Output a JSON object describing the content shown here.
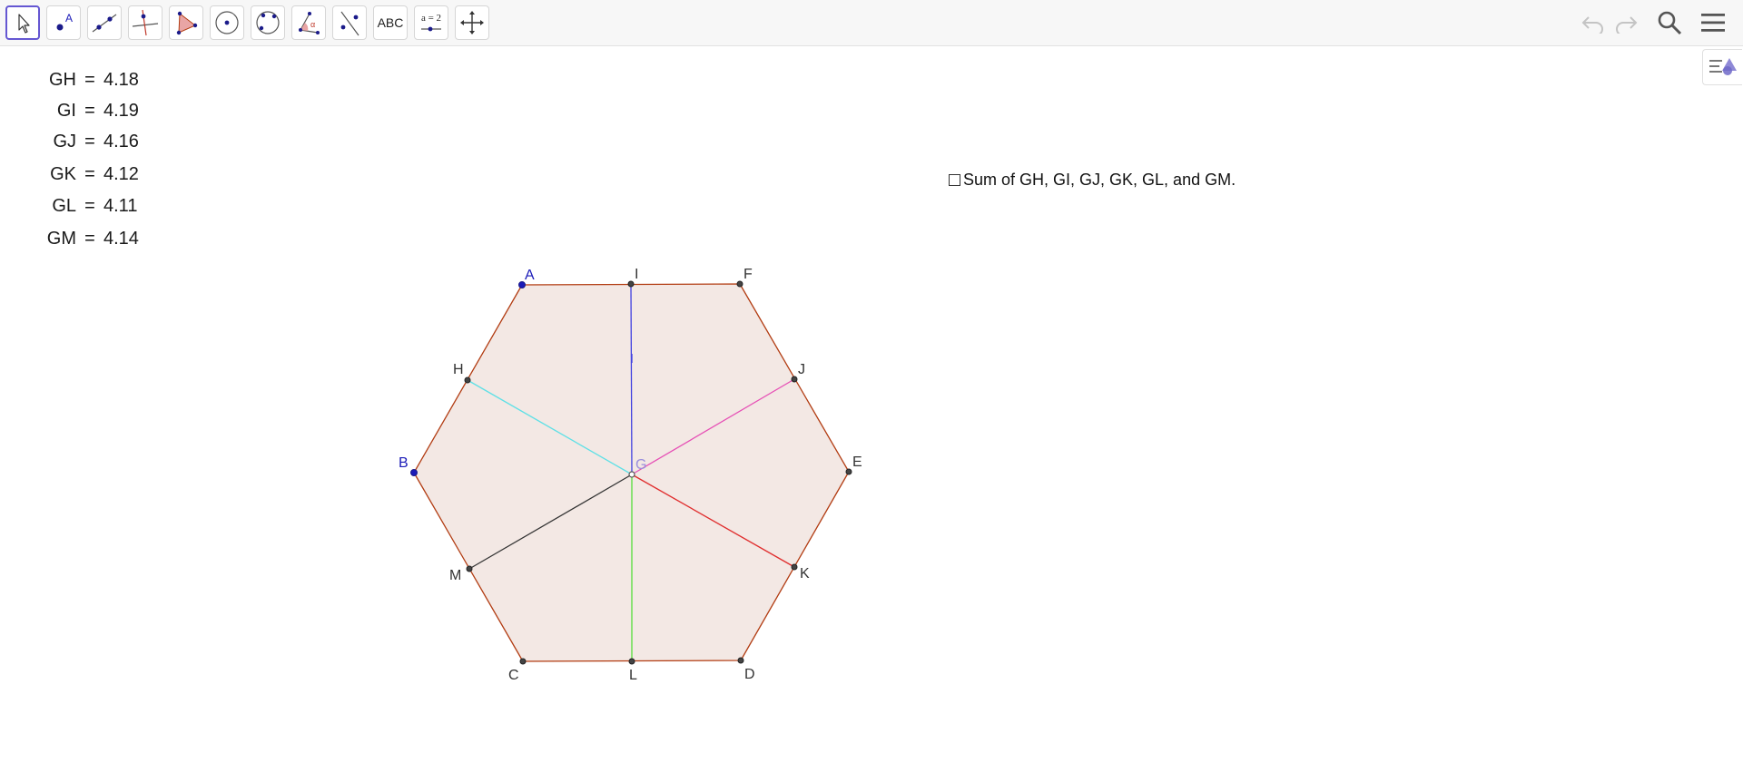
{
  "toolbar": {
    "tools": [
      {
        "name": "move-tool",
        "icon": "cursor-icon"
      },
      {
        "name": "point-tool",
        "icon": "point-icon",
        "icon_label": "A"
      },
      {
        "name": "line-tool",
        "icon": "line-icon"
      },
      {
        "name": "perpendicular-line-tool",
        "icon": "perpendicular-icon"
      },
      {
        "name": "polygon-tool",
        "icon": "polygon-icon"
      },
      {
        "name": "circle-center-point-tool",
        "icon": "circle-center-icon"
      },
      {
        "name": "circle-three-points-tool",
        "icon": "circle-three-points-icon"
      },
      {
        "name": "angle-tool",
        "icon": "angle-icon",
        "icon_label": "α"
      },
      {
        "name": "reflect-tool",
        "icon": "reflect-icon"
      },
      {
        "name": "text-tool",
        "icon": "text-icon",
        "label": "ABC"
      },
      {
        "name": "slider-tool",
        "icon": "slider-icon",
        "label": "a = 2"
      },
      {
        "name": "move-graphics-view-tool",
        "icon": "move-view-icon"
      }
    ],
    "right_controls": [
      {
        "name": "undo-button",
        "icon": "undo-icon"
      },
      {
        "name": "redo-button",
        "icon": "redo-icon"
      },
      {
        "name": "search-button",
        "icon": "search-icon"
      },
      {
        "name": "menu-button",
        "icon": "hamburger-menu-icon"
      }
    ]
  },
  "style_bar_toggle": {
    "icon": "style-bar-icon"
  },
  "measurements": [
    {
      "name": "GH",
      "eq": "=",
      "value": "4.18"
    },
    {
      "name": "GI",
      "eq": "=",
      "value": "4.19"
    },
    {
      "name": "GJ",
      "eq": "=",
      "value": "4.16"
    },
    {
      "name": "GK",
      "eq": "=",
      "value": "4.12"
    },
    {
      "name": "GL",
      "eq": "=",
      "value": "4.11"
    },
    {
      "name": "GM",
      "eq": "=",
      "value": "4.14"
    }
  ],
  "checkbox": {
    "label": "Sum of GH, GI, GJ, GK, GL, and GM.",
    "checked": false
  },
  "construction": {
    "polygon_vertices": [
      "A",
      "F",
      "E",
      "D",
      "C",
      "B"
    ],
    "polygon_fill": "#f3e8e4",
    "polygon_edge_color": "#b23c12",
    "segments": [
      {
        "from": "G",
        "to": "I",
        "color": "#4040e0"
      },
      {
        "from": "G",
        "to": "H",
        "color": "#5ee0e6"
      },
      {
        "from": "G",
        "to": "J",
        "color": "#e64fb5"
      },
      {
        "from": "G",
        "to": "K",
        "color": "#e02d2d"
      },
      {
        "from": "G",
        "to": "L",
        "color": "#55dd3a"
      },
      {
        "from": "G",
        "to": "M",
        "color": "#333333"
      }
    ],
    "points": [
      {
        "label": "A",
        "color": "#1b1bb8",
        "style": "free"
      },
      {
        "label": "B",
        "color": "#1b1bb8",
        "style": "free"
      },
      {
        "label": "C",
        "color": "#333333",
        "style": "dependent"
      },
      {
        "label": "D",
        "color": "#333333",
        "style": "dependent"
      },
      {
        "label": "E",
        "color": "#333333",
        "style": "dependent"
      },
      {
        "label": "F",
        "color": "#333333",
        "style": "dependent"
      },
      {
        "label": "G",
        "color": "#9a8fdc",
        "style": "on-object"
      },
      {
        "label": "H",
        "color": "#333333",
        "style": "dependent"
      },
      {
        "label": "I",
        "color": "#333333",
        "style": "dependent"
      },
      {
        "label": "J",
        "color": "#333333",
        "style": "dependent"
      },
      {
        "label": "K",
        "color": "#333333",
        "style": "dependent"
      },
      {
        "label": "L",
        "color": "#333333",
        "style": "dependent"
      },
      {
        "label": "M",
        "color": "#333333",
        "style": "dependent"
      }
    ]
  }
}
